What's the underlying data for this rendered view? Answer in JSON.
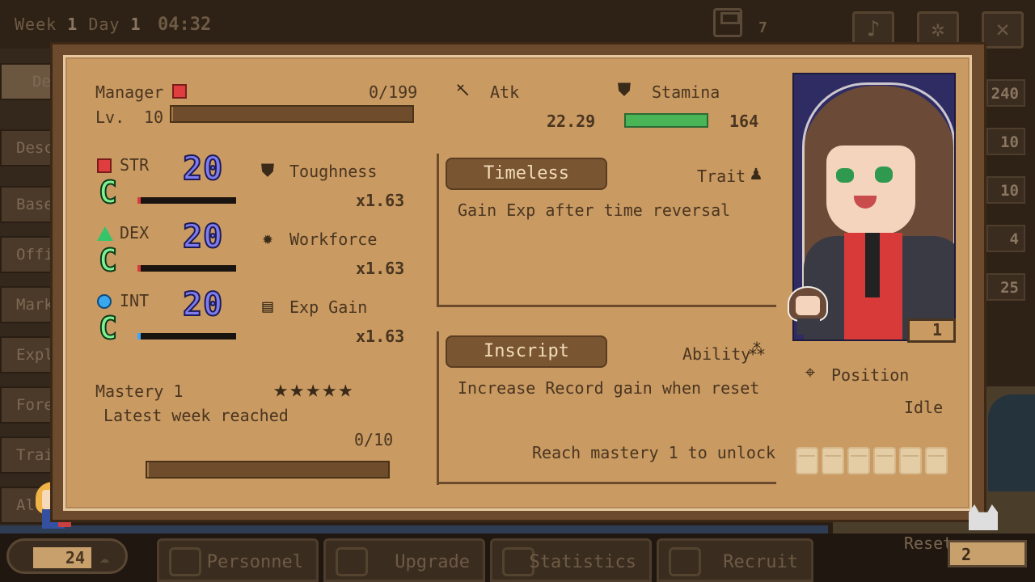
{
  "topbar": {
    "week_label": "Week",
    "week": "1",
    "day_label": "Day",
    "day": "1",
    "time": "04:32",
    "save_count": "7"
  },
  "sidebar": {
    "items": [
      "De",
      "Desc",
      "Base",
      "Offi",
      "Mark",
      "Expl",
      "Fore",
      "Trai",
      "All"
    ]
  },
  "right_numbers": [
    "240",
    "10",
    "10",
    "4",
    "25"
  ],
  "bottombar": {
    "count": "24",
    "tabs": [
      "Personnel",
      "Upgrade",
      "Statistics",
      "Recruit"
    ],
    "reset_label": "Reset",
    "reset_value": "2"
  },
  "character": {
    "role": "Manager",
    "exp": "0/199",
    "level_label": "Lv.",
    "level": "10",
    "exp_fraction": 0.0,
    "portrait_level": "1",
    "stats": [
      {
        "name": "STR",
        "value": "20",
        "grade": "C",
        "bar": 0.02,
        "shape": "red-square"
      },
      {
        "name": "DEX",
        "value": "20",
        "grade": "C",
        "bar": 0.0,
        "shape": "green-triangle"
      },
      {
        "name": "INT",
        "value": "20",
        "grade": "C",
        "bar": 0.02,
        "shape": "blue-circle"
      }
    ],
    "modifiers": [
      {
        "name": "Toughness",
        "value": "x1.63",
        "icon": "shield-icon"
      },
      {
        "name": "Workforce",
        "value": "x1.63",
        "icon": "gear-icon"
      },
      {
        "name": "Exp Gain",
        "value": "x1.63",
        "icon": "book-icon"
      }
    ],
    "atk_label": "Atk",
    "atk_value": "22.29",
    "stamina_label": "Stamina",
    "stamina_value": "164",
    "stamina_fraction": 1.0,
    "mastery": {
      "label": "Mastery 1",
      "stars": "★★★★★",
      "description": "Latest week reached",
      "progress_text": "0/10",
      "progress_fraction": 0.0
    },
    "trait": {
      "name": "Timeless",
      "kind": "Trait",
      "description": "Gain Exp after time reversal"
    },
    "ability": {
      "name": "Inscript",
      "kind": "Ability",
      "description": "Increase Record gain when reset",
      "locked_note": "Reach mastery 1 to unlock"
    },
    "position_label": "Position",
    "position_value": "Idle",
    "equipment_slots": 6
  },
  "colors": {
    "panel": "#c99a62",
    "text": "#4a3520",
    "stat_number": "#7f7cf0",
    "grade": "#7ff090",
    "stamina": "#49b557"
  }
}
